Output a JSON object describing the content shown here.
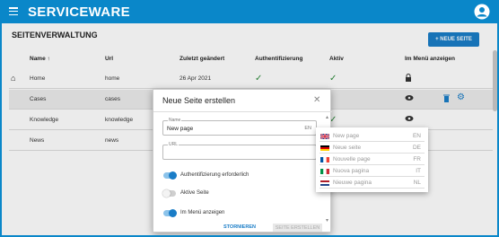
{
  "app": {
    "brand": "SERVICEWARE"
  },
  "page": {
    "title": "SEITENVERWALTUNG",
    "new_button": "+ NEUE SEITE"
  },
  "table": {
    "headers": {
      "name": "Name ↑",
      "url": "Url",
      "modified": "Zuletzt geändert",
      "auth": "Authentifizierung",
      "active": "Aktiv",
      "menu": "Im Menü anzeigen"
    },
    "rows": [
      {
        "name": "Home",
        "url": "home",
        "modified": "26 Apr 2021"
      },
      {
        "name": "Cases",
        "url": "cases",
        "modified": ""
      },
      {
        "name": "Knowledge",
        "url": "knowledge",
        "modified": ""
      },
      {
        "name": "News",
        "url": "news",
        "modified": ""
      }
    ]
  },
  "dialog": {
    "title": "Neue Seite erstellen",
    "name_label": "Name",
    "name_value": "New page",
    "name_lang": "EN",
    "url_label": "URL",
    "toggles": [
      {
        "label": "Authentifizierung erforderlich",
        "on": true
      },
      {
        "label": "Aktive Seite",
        "on": false
      },
      {
        "label": "Im Menü anzeigen",
        "on": true
      }
    ],
    "cancel": "STORNIEREN",
    "create": "SEITE ERSTELLEN"
  },
  "languages": [
    {
      "name": "New page",
      "code": "EN"
    },
    {
      "name": "Neue seite",
      "code": "DE"
    },
    {
      "name": "Nouvelle page",
      "code": "FR"
    },
    {
      "name": "Nuova pagina",
      "code": "IT"
    },
    {
      "name": "Nieuwe pagina",
      "code": "NL"
    }
  ],
  "colors": {
    "brand": "#0a87c9",
    "button": "#1a7dc7",
    "check": "#2e8b3c"
  }
}
